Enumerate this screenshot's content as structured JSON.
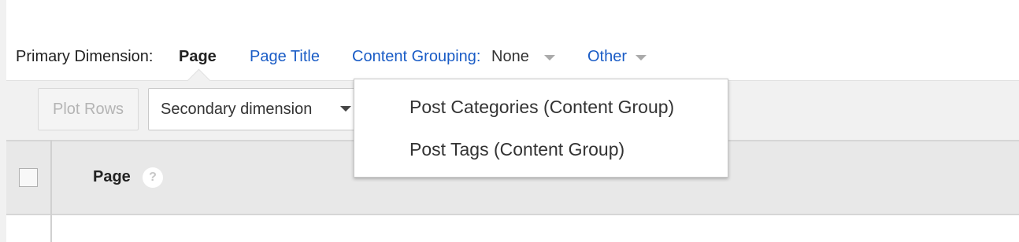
{
  "primary_dimension": {
    "label": "Primary Dimension:",
    "active": "Page",
    "page_title_link": "Page Title",
    "content_grouping_label": "Content Grouping:",
    "content_grouping_value": "None",
    "other_link": "Other"
  },
  "toolbar": {
    "plot_rows_label": "Plot Rows",
    "secondary_dimension_label": "Secondary dimension"
  },
  "table": {
    "columns": [
      {
        "label": "Page",
        "help": "?"
      }
    ]
  },
  "content_grouping_menu": {
    "items": [
      {
        "label": "Post Categories (Content Group)"
      },
      {
        "label": "Post Tags (Content Group)"
      }
    ]
  },
  "colors": {
    "link": "#1a5cc6",
    "toolbar_bg": "#f1f1f1",
    "header_bg": "#e8e8e8"
  },
  "icons": [
    "caret-down-icon",
    "help-icon"
  ]
}
